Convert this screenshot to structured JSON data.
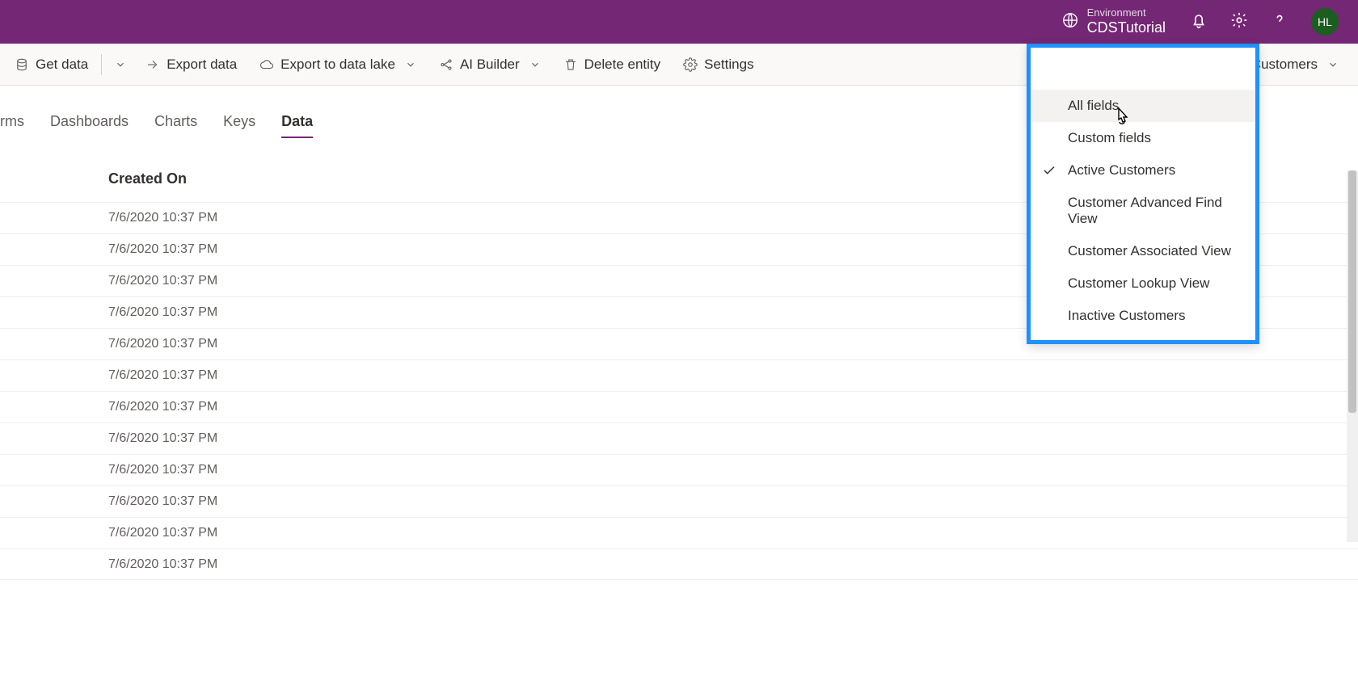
{
  "topbar": {
    "env_label": "Environment",
    "env_name": "CDSTutorial",
    "avatar_initials": "HL"
  },
  "commandbar": {
    "get_data": "Get data",
    "export_data": "Export data",
    "export_lake": "Export to data lake",
    "ai_builder": "AI Builder",
    "delete_entity": "Delete entity",
    "settings": "Settings",
    "view_selector": "Active Customers"
  },
  "tabs": {
    "forms": "orms",
    "dashboards": "Dashboards",
    "charts": "Charts",
    "keys": "Keys",
    "data": "Data"
  },
  "table": {
    "col_created_on": "Created On",
    "rows": [
      "7/6/2020 10:37 PM",
      "7/6/2020 10:37 PM",
      "7/6/2020 10:37 PM",
      "7/6/2020 10:37 PM",
      "7/6/2020 10:37 PM",
      "7/6/2020 10:37 PM",
      "7/6/2020 10:37 PM",
      "7/6/2020 10:37 PM",
      "7/6/2020 10:37 PM",
      "7/6/2020 10:37 PM",
      "7/6/2020 10:37 PM",
      "7/6/2020 10:37 PM"
    ]
  },
  "dropdown": {
    "all_fields": "All fields",
    "custom_fields": "Custom fields",
    "active_customers": "Active Customers",
    "adv_find": "Customer Advanced Find View",
    "associated": "Customer Associated View",
    "lookup": "Customer Lookup View",
    "inactive": "Inactive Customers"
  }
}
